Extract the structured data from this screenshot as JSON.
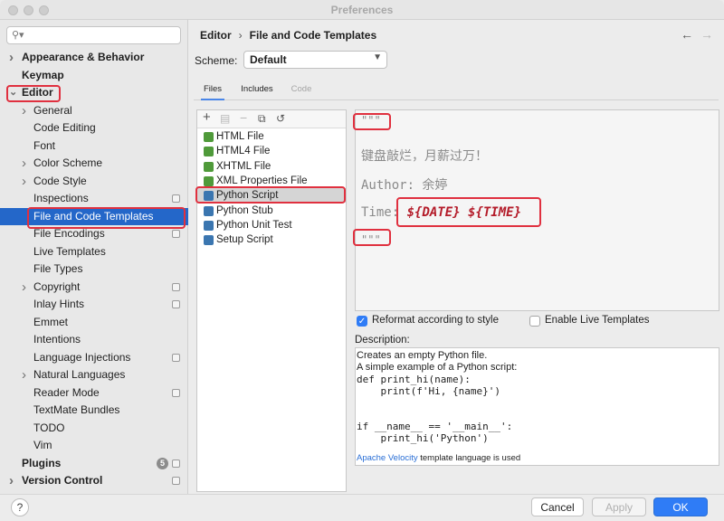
{
  "window": {
    "title": "Preferences"
  },
  "search": {
    "placeholder": ""
  },
  "sidebar": {
    "items": [
      {
        "label": "Appearance & Behavior",
        "level": 0,
        "chevron": "right"
      },
      {
        "label": "Keymap",
        "level": 0
      },
      {
        "label": "Editor",
        "level": 0,
        "chevron": "down"
      },
      {
        "label": "General",
        "level": 1,
        "chevron": "right"
      },
      {
        "label": "Code Editing",
        "level": 1
      },
      {
        "label": "Font",
        "level": 1
      },
      {
        "label": "Color Scheme",
        "level": 1,
        "chevron": "right"
      },
      {
        "label": "Code Style",
        "level": 1,
        "chevron": "right"
      },
      {
        "label": "Inspections",
        "level": 1,
        "config": true
      },
      {
        "label": "File and Code Templates",
        "level": 1,
        "selected": true
      },
      {
        "label": "File Encodings",
        "level": 1,
        "config": true
      },
      {
        "label": "Live Templates",
        "level": 1
      },
      {
        "label": "File Types",
        "level": 1
      },
      {
        "label": "Copyright",
        "level": 1,
        "chevron": "right",
        "config": true
      },
      {
        "label": "Inlay Hints",
        "level": 1,
        "config": true
      },
      {
        "label": "Emmet",
        "level": 1
      },
      {
        "label": "Intentions",
        "level": 1
      },
      {
        "label": "Language Injections",
        "level": 1,
        "config": true
      },
      {
        "label": "Natural Languages",
        "level": 1,
        "chevron": "right"
      },
      {
        "label": "Reader Mode",
        "level": 1,
        "config": true
      },
      {
        "label": "TextMate Bundles",
        "level": 1
      },
      {
        "label": "TODO",
        "level": 1
      },
      {
        "label": "Vim",
        "level": 1
      },
      {
        "label": "Plugins",
        "level": 0,
        "badge": "5",
        "config": true
      },
      {
        "label": "Version Control",
        "level": 0,
        "chevron": "right",
        "config": true
      }
    ]
  },
  "breadcrumb": {
    "parent": "Editor",
    "separator": "›",
    "current": "File and Code Templates"
  },
  "nav": {
    "back_icon": "arrow-left-icon",
    "forward_icon": "arrow-right-icon"
  },
  "scheme": {
    "label": "Scheme:",
    "value": "Default"
  },
  "tabs": [
    {
      "label": "Files",
      "active": true
    },
    {
      "label": "Includes"
    },
    {
      "label": "Code",
      "disabled": true
    }
  ],
  "toolbar_icons": [
    "add-icon",
    "copy-template-icon",
    "remove-icon",
    "duplicate-icon",
    "reset-icon"
  ],
  "templates": [
    {
      "label": "HTML File",
      "icon_color": "#4f9a3a"
    },
    {
      "label": "HTML4 File",
      "icon_color": "#4f9a3a"
    },
    {
      "label": "XHTML File",
      "icon_color": "#4f9a3a"
    },
    {
      "label": "XML Properties File",
      "icon_color": "#4f9a3a"
    },
    {
      "label": "Python Script",
      "icon_color": "#3b76b0",
      "selected": true
    },
    {
      "label": "Python Stub",
      "icon_color": "#3b76b0"
    },
    {
      "label": "Python Unit Test",
      "icon_color": "#3b76b0"
    },
    {
      "label": "Setup Script",
      "icon_color": "#3b76b0"
    }
  ],
  "editor": {
    "quote_open": "\"\"\"",
    "line1": "键盘敲烂，月薪过万！",
    "author": "Author: 余婷",
    "time_label": "Time:",
    "time_vars": "${DATE} ${TIME}",
    "quote_close": "\"\"\""
  },
  "options": {
    "reformat": {
      "label": "Reformat according to style",
      "checked": true
    },
    "live_templates": {
      "label": "Enable Live Templates",
      "checked": false
    }
  },
  "description": {
    "label": "Description:",
    "lines": [
      "Creates an empty Python file.",
      "A simple example of a Python script:",
      "def print_hi(name):",
      "    print(f'Hi, {name}')",
      "",
      "",
      "if __name__ == '__main__':",
      "    print_hi('Python')"
    ],
    "footer_link": "Apache Velocity",
    "footer_text": " template language is used"
  },
  "buttons": {
    "help": "?",
    "cancel": "Cancel",
    "apply": "Apply",
    "ok": "OK"
  },
  "colors": {
    "selection": "#2467c9",
    "primary": "#2f7cf6",
    "highlight": "#e0303f",
    "template_var": "#b41c2a"
  }
}
